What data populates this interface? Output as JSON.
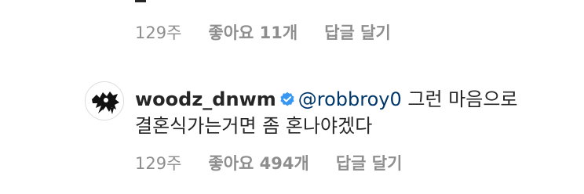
{
  "previous_comment": {
    "time": "129주",
    "likes": "좋아요 11개",
    "reply": "답글 달기"
  },
  "comment": {
    "username": "woodz_dnwm",
    "mention": "@robbroy0",
    "text_line1": " 그런 마음으로",
    "text_line2": "결혼식가는거면 좀 혼나야겠다",
    "time": "129주",
    "likes": "좋아요 494개",
    "reply": "답글 달기",
    "verified_badge_color": "#3897f0",
    "mention_color": "#00376b"
  }
}
